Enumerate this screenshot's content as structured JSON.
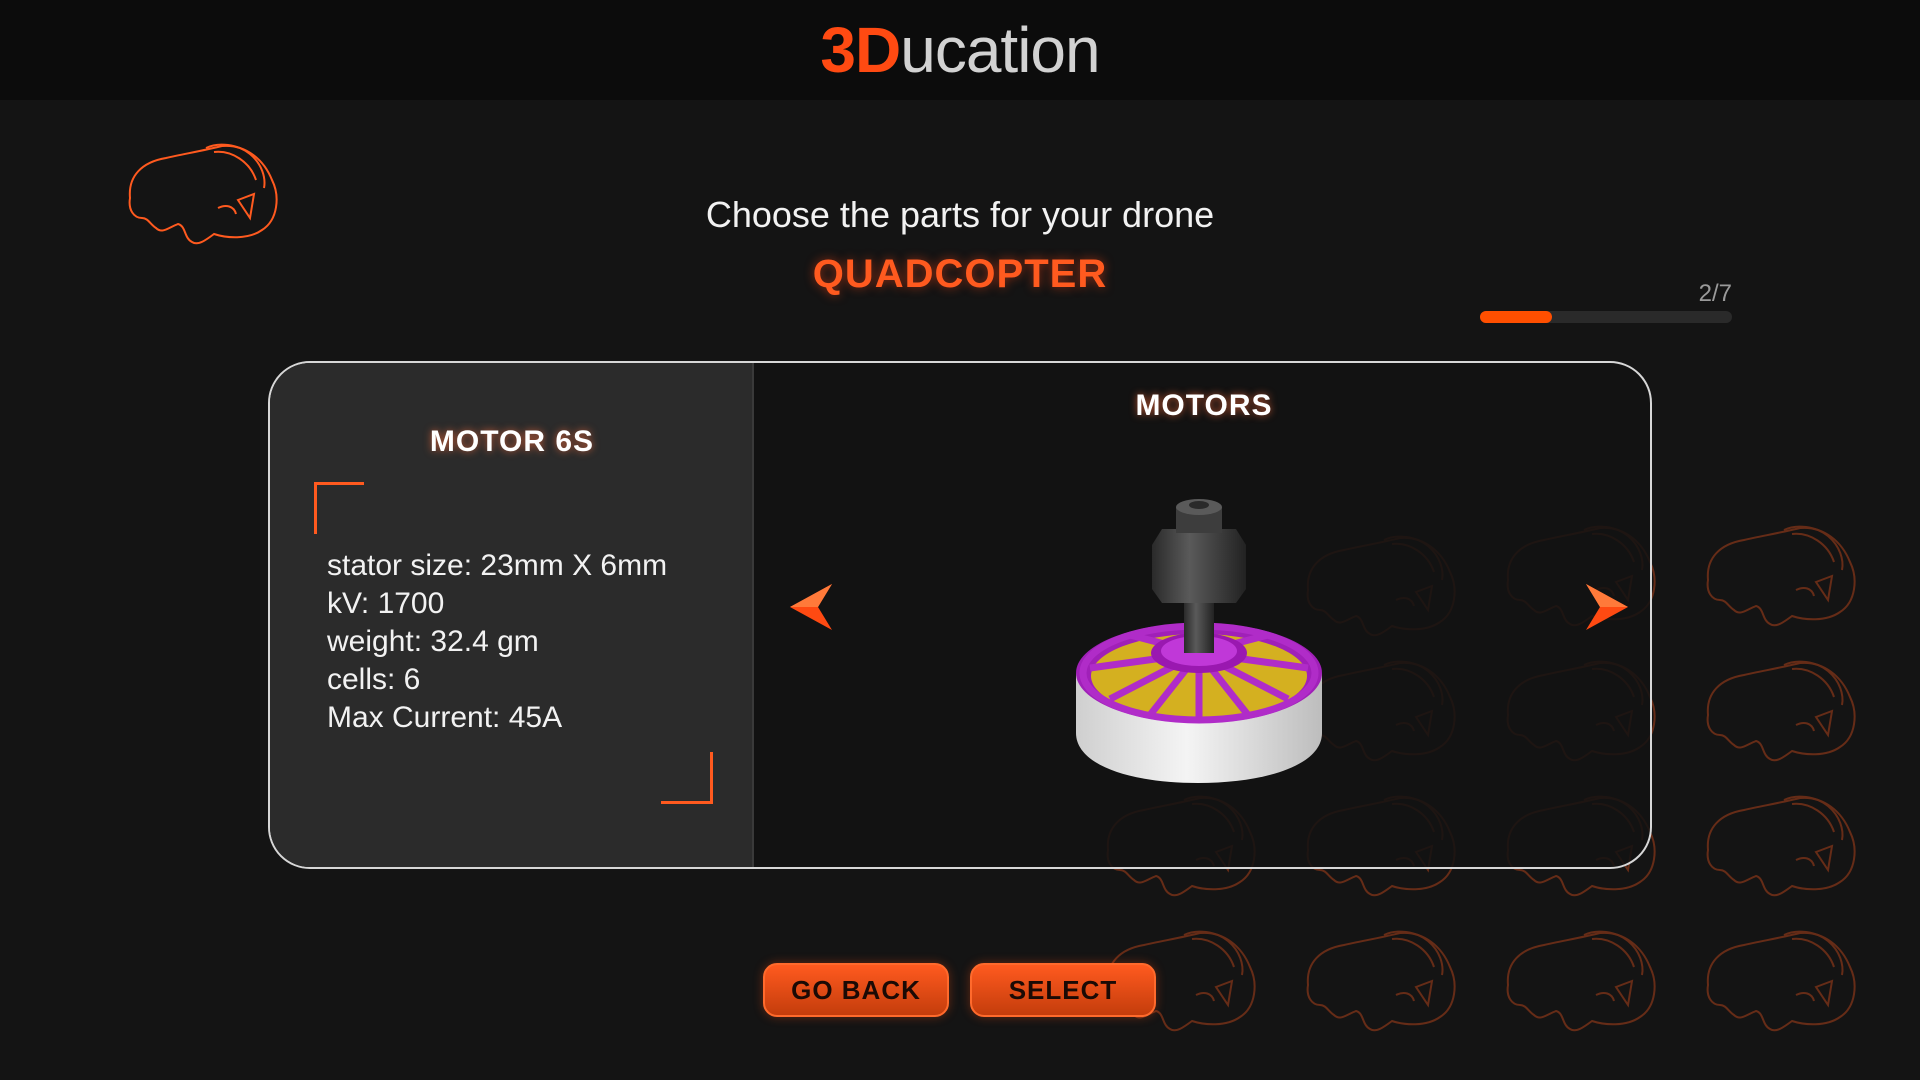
{
  "header": {
    "logo_accent": "3D",
    "logo_rest": "ucation"
  },
  "page": {
    "heading": "Choose the parts for your drone",
    "drone_type": "QUADCOPTER"
  },
  "progress": {
    "label": "2/7",
    "fraction": 0.2857
  },
  "part": {
    "name": "MOTOR 6S",
    "specs": [
      "stator size: 23mm X 6mm",
      "kV: 1700",
      "weight: 32.4 gm",
      "cells: 6",
      "Max Current: 45A"
    ]
  },
  "category": "MOTORS",
  "buttons": {
    "back": "GO BACK",
    "select": "SELECT"
  },
  "icons": {
    "vr_headset": "vr-headset-icon",
    "prev": "arrow-left-icon",
    "next": "arrow-right-icon"
  },
  "colors": {
    "accent": "#ff4f00",
    "panel": "#2b2b2b",
    "background": "#141414"
  }
}
